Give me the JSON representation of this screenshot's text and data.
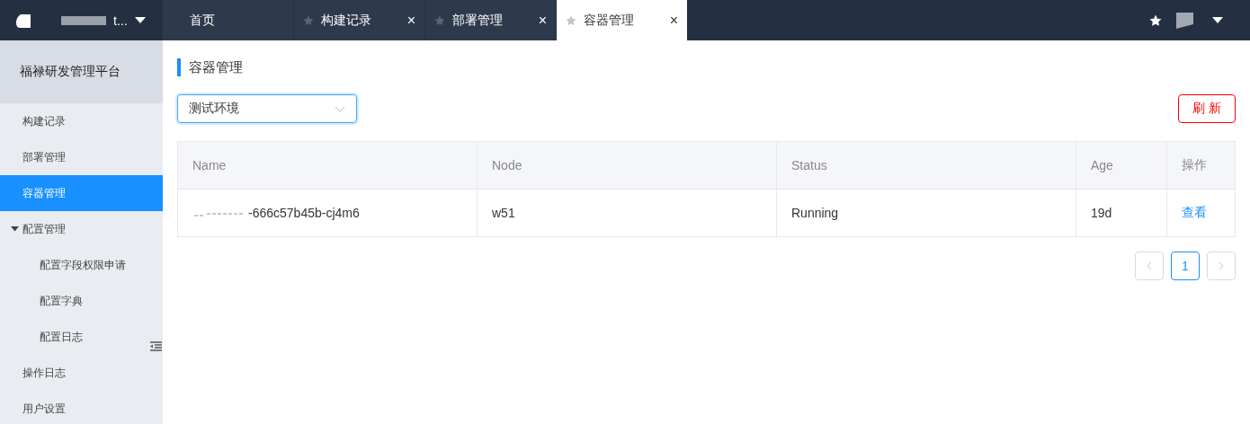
{
  "header": {
    "brand_text": "t...",
    "tabs": [
      {
        "label": "首页",
        "selected": false,
        "closable": false,
        "starred": false
      },
      {
        "label": "构建记录",
        "selected": false,
        "closable": true,
        "starred": true
      },
      {
        "label": "部署管理",
        "selected": false,
        "closable": true,
        "starred": true
      },
      {
        "label": "容器管理",
        "selected": true,
        "closable": true,
        "starred": true
      }
    ],
    "close_glyph": "×"
  },
  "sidebar": {
    "title": "福禄研发管理平台",
    "items": [
      {
        "label": "构建记录",
        "selected": false
      },
      {
        "label": "部署管理",
        "selected": false
      },
      {
        "label": "容器管理",
        "selected": true
      },
      {
        "label": "配置管理",
        "selected": false,
        "expanded": true,
        "children": [
          {
            "label": "配置字段权限申请",
            "selected": false
          },
          {
            "label": "配置字典",
            "selected": false
          },
          {
            "label": "配置日志",
            "selected": false
          }
        ]
      },
      {
        "label": "操作日志",
        "selected": false
      },
      {
        "label": "用户设置",
        "selected": false
      }
    ]
  },
  "page": {
    "title": "容器管理",
    "environment_select": {
      "value": "测试环境"
    },
    "refresh_button": "刷 新",
    "table": {
      "columns": [
        "Name",
        "Node",
        "Status",
        "Age",
        "操作"
      ],
      "rows": [
        {
          "name": "-666c57b45b-cj4m6",
          "node": "w51",
          "status": "Running",
          "age": "19d",
          "action": "查看"
        }
      ]
    },
    "pagination": {
      "pages": [
        {
          "label": "1",
          "selected": true
        }
      ]
    }
  }
}
